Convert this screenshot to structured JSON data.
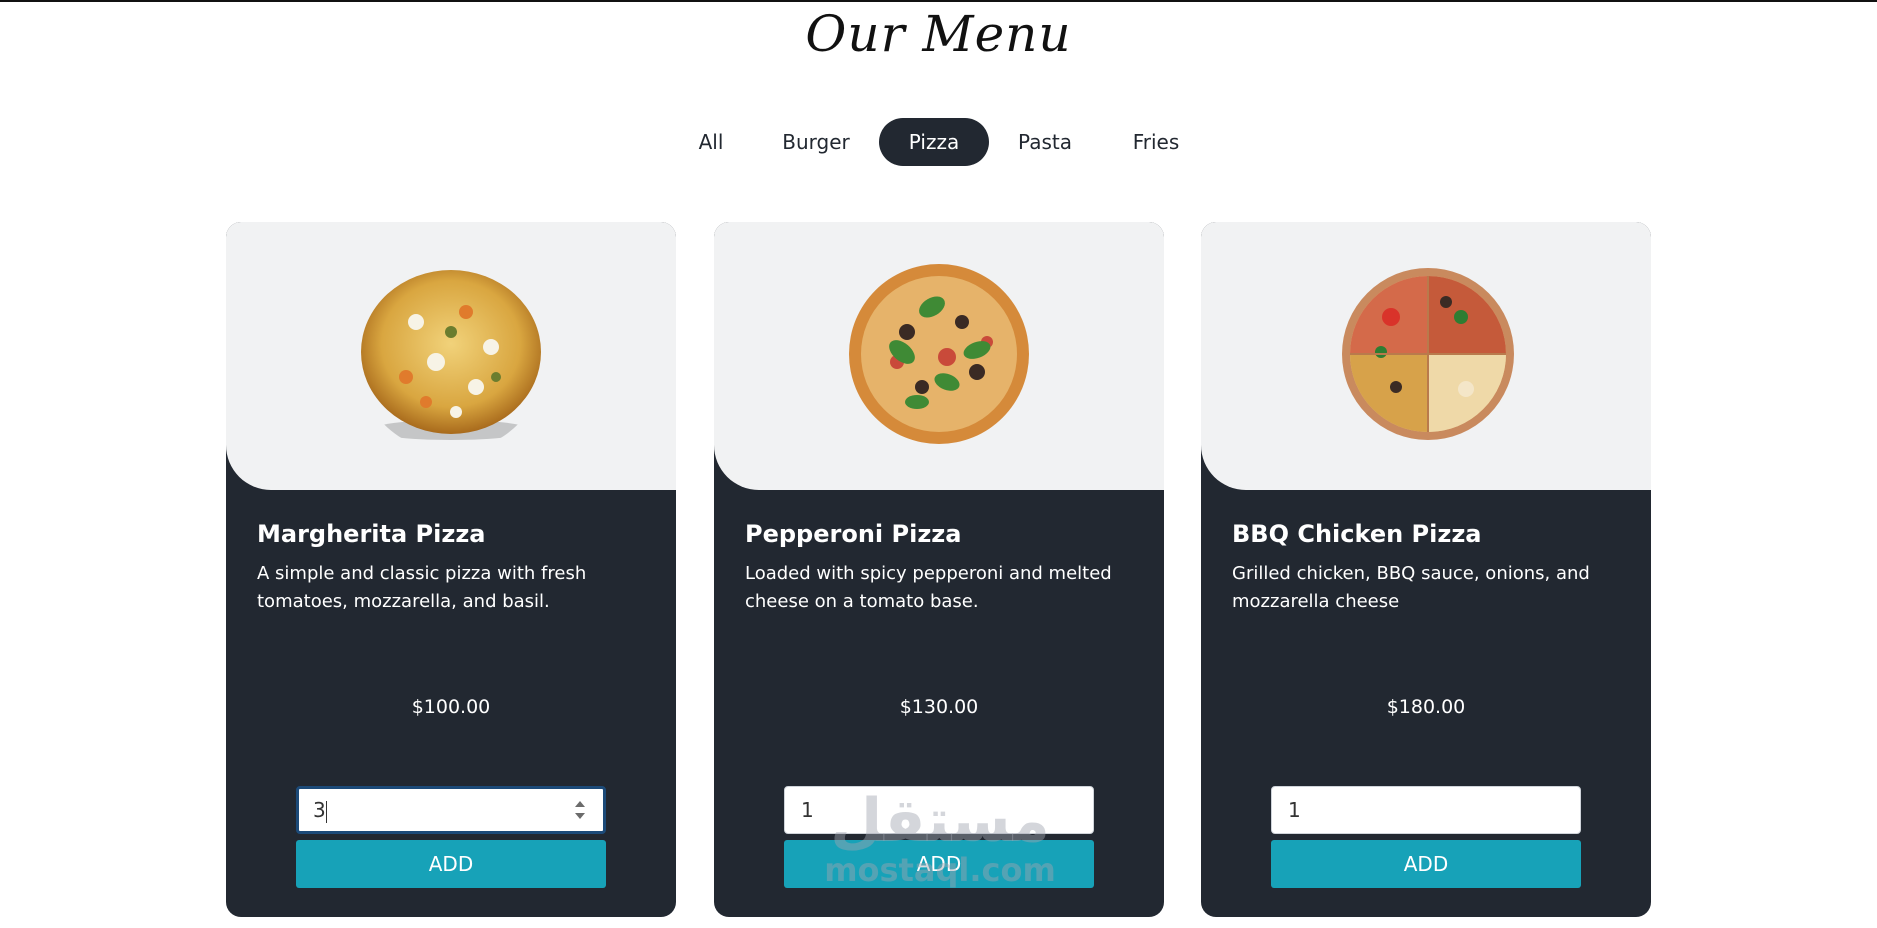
{
  "page": {
    "title": "Our Menu"
  },
  "filters": [
    {
      "label": "All",
      "active": false
    },
    {
      "label": "Burger",
      "active": false
    },
    {
      "label": "Pizza",
      "active": true
    },
    {
      "label": "Pasta",
      "active": false
    },
    {
      "label": "Fries",
      "active": false
    }
  ],
  "cards": [
    {
      "title": "Margherita Pizza",
      "description": "A simple and classic pizza with fresh tomatoes, mozzarella, and basil.",
      "price": "$100.00",
      "quantity": "3",
      "add_label": "ADD"
    },
    {
      "title": "Pepperoni Pizza",
      "description": "Loaded with spicy pepperoni and melted cheese on a tomato base.",
      "price": "$130.00",
      "quantity": "1",
      "add_label": "ADD"
    },
    {
      "title": "BBQ Chicken Pizza",
      "description": "Grilled chicken, BBQ sauce, onions, and mozzarella cheese",
      "price": "$180.00",
      "quantity": "1",
      "add_label": "ADD"
    }
  ],
  "watermark": {
    "arabic": "مستقل",
    "latin": "mostaql.com"
  },
  "colors": {
    "dark": "#222831",
    "accent": "#17a2b8",
    "image_bg": "#f1f2f3"
  }
}
